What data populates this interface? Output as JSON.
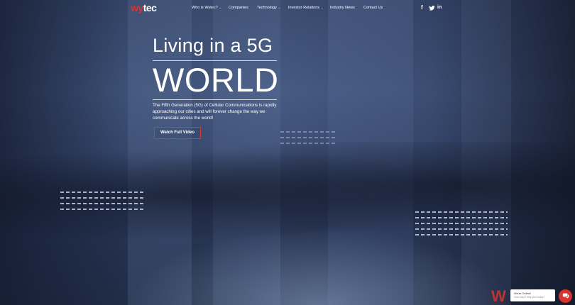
{
  "brand": {
    "logo_part1": "wy",
    "logo_part2": "tec",
    "accent_color": "#e0322c"
  },
  "nav": {
    "items": [
      {
        "label": "Who is Wytec?",
        "has_dropdown": true
      },
      {
        "label": "Companies",
        "has_dropdown": false
      },
      {
        "label": "Technology",
        "has_dropdown": true
      },
      {
        "label": "Investor Relations",
        "has_dropdown": true
      },
      {
        "label": "Industry News",
        "has_dropdown": false
      },
      {
        "label": "Contact Us",
        "has_dropdown": false
      }
    ],
    "caret": "⌄"
  },
  "social": {
    "facebook": "f",
    "twitter": "🐦",
    "linkedin": "in"
  },
  "hero": {
    "line1": "Living in a 5G",
    "line2": "WORLD",
    "description": "The Fifth Generation (5G) of Cellular Communications is rapidly approaching our cities and will forever change the way we communicate across the world!",
    "cta_label": "Watch Full Video"
  },
  "chat": {
    "title": "We're Online!",
    "subtitle": "How may I help you today?",
    "icon": "chat-icon"
  }
}
